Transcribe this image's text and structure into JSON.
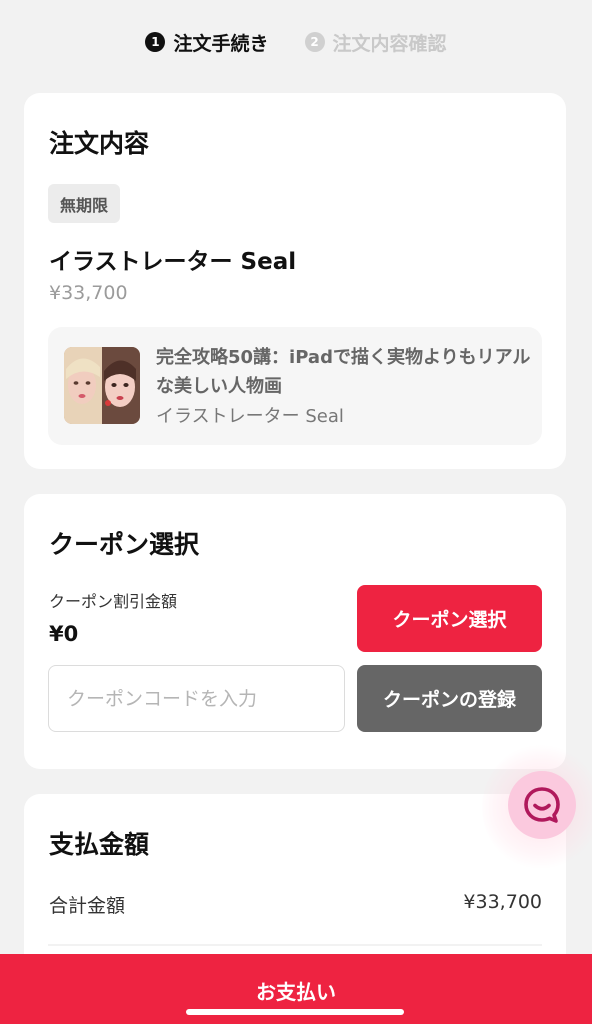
{
  "steps": [
    {
      "num": "1",
      "label": "注文手続き"
    },
    {
      "num": "2",
      "label": "注文内容確認"
    }
  ],
  "order": {
    "title": "注文内容",
    "tag": "無期限",
    "product_name": "イラストレーター Seal",
    "price": "¥33,700",
    "course": {
      "title": "完全攻略50講：iPadで描く実物よりもリアルな美しい人物画",
      "author": "イラストレーター Seal"
    }
  },
  "coupon": {
    "title": "クーポン選択",
    "discount_label": "クーポン割引金額",
    "discount_amount": "¥0",
    "select_button": "クーポン選択",
    "code_placeholder": "クーポンコードを入力",
    "register_button": "クーポンの登録"
  },
  "payment": {
    "title": "支払金額",
    "total_label": "合計金額",
    "total_value": "¥33,700",
    "pay_button": "お支払い"
  },
  "colors": {
    "accent": "#ee2341",
    "chat_bubble": "#fbc9de",
    "chat_icon": "#b0195c"
  },
  "icons": {
    "chat": "chat-smile-icon"
  }
}
